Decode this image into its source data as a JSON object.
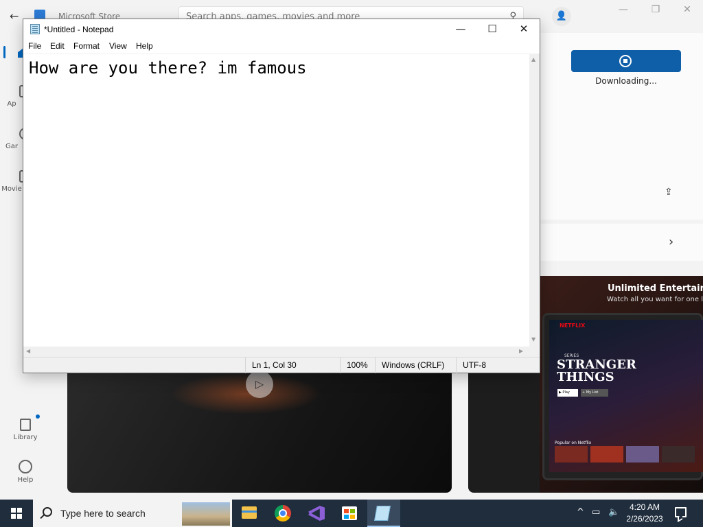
{
  "store": {
    "title": "Microsoft Store",
    "search_placeholder": "Search apps, games, movies and more",
    "nav": [
      {
        "label": "Ap"
      },
      {
        "label": "Gar"
      },
      {
        "label": "Movie"
      },
      {
        "label": "Library"
      },
      {
        "label": "Help"
      }
    ],
    "download_status": "Downloading...",
    "promo_title": "Unlimited Entertainm",
    "promo_subtitle": "Watch all you want for one lov",
    "tablet": {
      "brand": "NETFLIX",
      "series_tag": "SERIES",
      "show_title": "STRANGER THINGS",
      "play_label": "▶ Play",
      "mylist_label": "+ My List",
      "row_title": "Popular on Netflix"
    }
  },
  "notepad": {
    "title": "*Untitled - Notepad",
    "menu": [
      "File",
      "Edit",
      "Format",
      "View",
      "Help"
    ],
    "content": "How are you there? im famous",
    "status": {
      "position": "Ln 1, Col 30",
      "zoom": "100%",
      "line_endings": "Windows (CRLF)",
      "encoding": "UTF-8"
    }
  },
  "taskbar": {
    "search_text": "Type here to search",
    "time": "4:20 AM",
    "date": "2/26/2023",
    "pinned_apps": [
      "file-explorer",
      "chrome",
      "visual-studio",
      "microsoft-store",
      "notepad"
    ]
  },
  "colors": {
    "store_accent": "#0f5ea8",
    "taskbar_bg": "#1f2d3d",
    "netflix_red": "#e50914"
  }
}
